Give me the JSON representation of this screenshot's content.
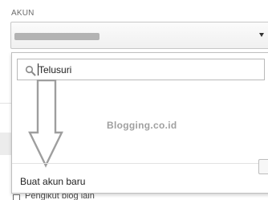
{
  "section": {
    "label": "AKUN"
  },
  "account_select": {
    "selected_value": ""
  },
  "dropdown": {
    "search": {
      "value": "Telusuri",
      "icon": "search-icon"
    },
    "watermark": "Blogging.co.id",
    "create_account_label": "Buat akun baru"
  },
  "bottom_row": {
    "label": "Pengikut blog lain"
  },
  "colors": {
    "border": "#c7c7c7",
    "mask": "#b3b3b3",
    "watermark": "#a0a0a0",
    "arrow": "#9e9e9e"
  }
}
